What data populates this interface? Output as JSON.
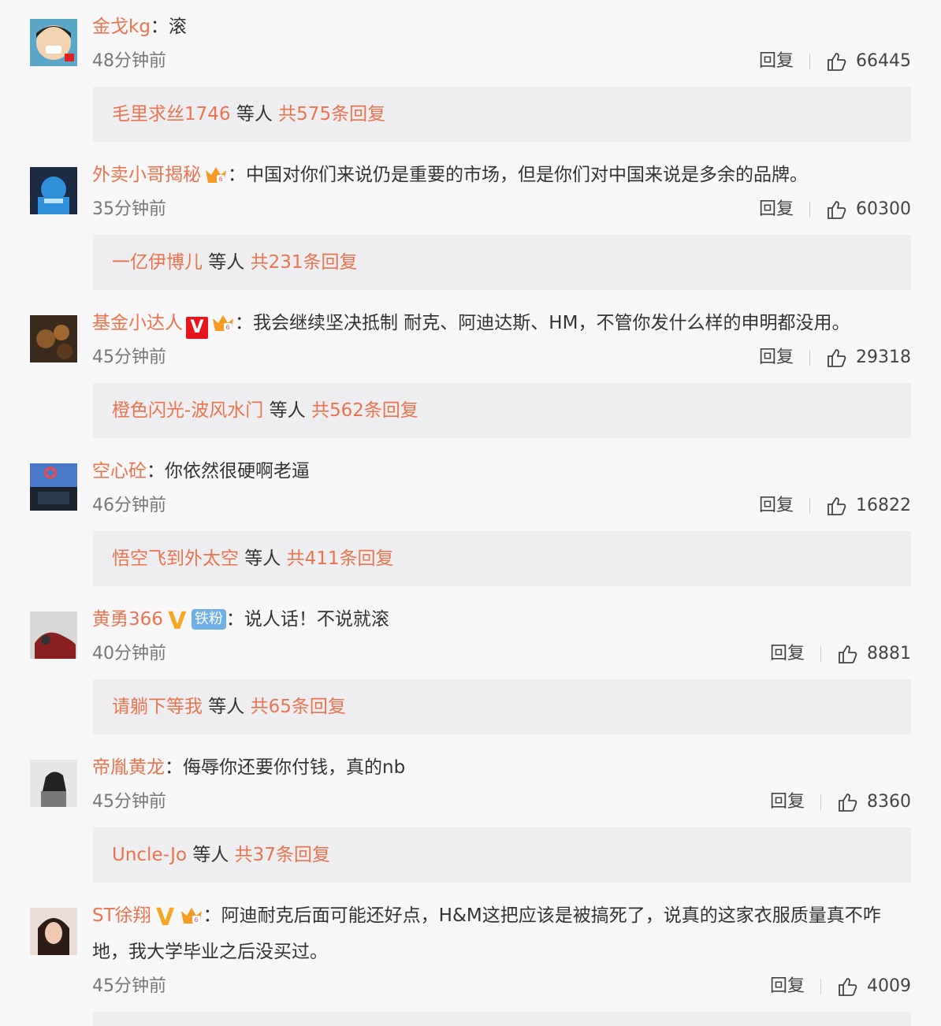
{
  "reply_label": "回复",
  "like_icon": "thumbs-up-icon",
  "colors": {
    "username": "#eb7350",
    "background": "#f7f7f8",
    "reply_box": "#eeeef0"
  },
  "comments": [
    {
      "user": "金戈kg",
      "sep": "：",
      "text": "滚",
      "time": "48分钟前",
      "likes": "66445",
      "reply_user": "毛里求丝1746",
      "reply_mid": " 等人 ",
      "reply_total": "共575条回复"
    },
    {
      "user": "外卖小哥揭秘",
      "sep": "：",
      "text": "中国对你们来说仍是重要的市场，但是你们对中国来说是多余的品牌。",
      "time": "35分钟前",
      "likes": "60300",
      "reply_user": "一亿伊博儿",
      "reply_mid": " 等人 ",
      "reply_total": "共231条回复"
    },
    {
      "user": "基金小达人",
      "sep": "：",
      "text": "我会继续坚决抵制  耐克、阿迪达斯、HM，不管你发什么样的申明都没用。",
      "time": "45分钟前",
      "likes": "29318",
      "reply_user": "橙色闪光-波风水门",
      "reply_mid": " 等人 ",
      "reply_total": "共562条回复"
    },
    {
      "user": "空心砼",
      "sep": "：",
      "text": "你依然很硬啊老逼",
      "time": "46分钟前",
      "likes": "16822",
      "reply_user": "悟空飞到外太空",
      "reply_mid": " 等人 ",
      "reply_total": "共411条回复"
    },
    {
      "user": "黄勇366",
      "sep": "：",
      "text": "说人话！不说就滚",
      "badge_fan": "铁粉",
      "time": "40分钟前",
      "likes": "8881",
      "reply_user": "请躺下等我",
      "reply_mid": " 等人 ",
      "reply_total": "共65条回复"
    },
    {
      "user": "帝胤黄龙",
      "sep": "：",
      "text": "侮辱你还要你付钱，真的nb",
      "time": "45分钟前",
      "likes": "8360",
      "reply_user": "Uncle-Jo",
      "reply_mid": " 等人 ",
      "reply_total": "共37条回复"
    },
    {
      "user": "ST徐翔",
      "sep": "：",
      "text": "阿迪耐克后面可能还好点，H&M这把应该是被搞死了，说真的这家衣服质量真不咋地，我大学毕业之后没买过。",
      "time": "45分钟前",
      "likes": "4009"
    }
  ]
}
